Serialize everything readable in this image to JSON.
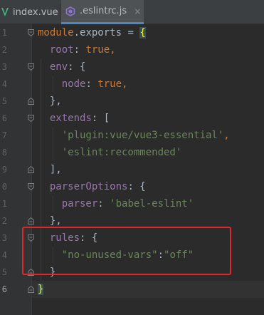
{
  "tabs": [
    {
      "label": "index.vue",
      "icon": "vue-icon",
      "active": false
    },
    {
      "label": ".eslintrc.js",
      "icon": "eslint-icon",
      "active": true,
      "close": "×"
    }
  ],
  "gutter": {
    "line_numbers": [
      "1",
      "2",
      "3",
      "4",
      "5",
      "6",
      "7",
      "8",
      "9",
      "0",
      "1",
      "2",
      "3",
      "4",
      "5",
      "6"
    ]
  },
  "code": {
    "l1_a": "module",
    "l1_b": ".",
    "l1_c": "exports",
    "l1_d": " = ",
    "l1_e": "{",
    "l2_a": "  root",
    "l2_b": ": ",
    "l2_c": "true",
    "l2_d": ",",
    "l3_a": "  env",
    "l3_b": ": {",
    "l4_a": "    node",
    "l4_b": ": ",
    "l4_c": "true",
    "l4_d": ",",
    "l5": "  },",
    "l6_a": "  extends",
    "l6_b": ": [",
    "l7_a": "    ",
    "l7_b": "'plugin:vue/vue3-essential'",
    "l7_c": ",",
    "l8_a": "    ",
    "l8_b": "'eslint:recommended'",
    "l9": "  ],",
    "l10_a": "  parserOptions",
    "l10_b": ": {",
    "l11_a": "    parser",
    "l11_b": ": ",
    "l11_c": "'babel-eslint'",
    "l12": "  },",
    "l13_a": "  rules",
    "l13_b": ": {",
    "l14_a": "    ",
    "l14_b": "\"no-unused-vars\"",
    "l14_c": ":",
    "l14_d": "\"off\"",
    "l15": "  }",
    "l16": "}"
  },
  "colors": {
    "background": "#2b2b2b",
    "keyword": "#cc7832",
    "string": "#6a8759",
    "property": "#9876aa",
    "annotation_box": "#e0282c",
    "brace_match": "#ffef28"
  }
}
